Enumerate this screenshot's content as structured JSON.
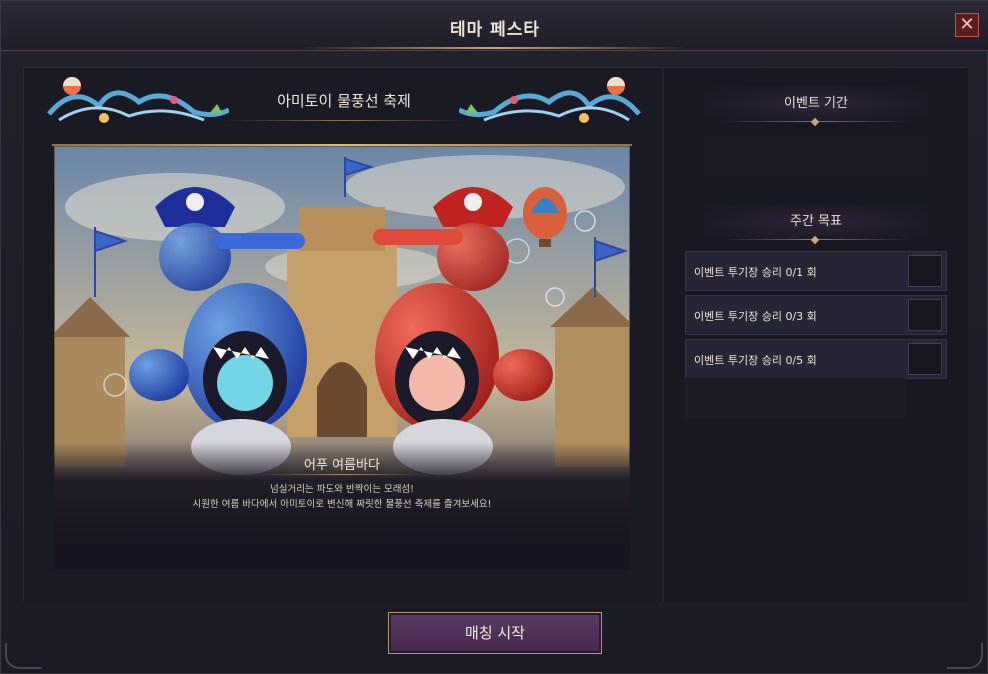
{
  "window": {
    "title": "테마 페스타",
    "close_label": "✕"
  },
  "event": {
    "name": "아미토이 물풍선 축제",
    "subtitle": "어푸 여름바다",
    "description_line1": "넘실거리는 파도와 반짝이는 모래섬!",
    "description_line2": "시원한 여름 바다에서 아미토이로 변신해 짜릿한 물풍선 축제를 즐겨보세요!"
  },
  "sidebar": {
    "period_title": "이벤트 기간",
    "weekly_goal_title": "주간 목표",
    "goals": [
      {
        "label": "이벤트 투기장 승리 0/1 회"
      },
      {
        "label": "이벤트 투기장 승리 0/3 회"
      },
      {
        "label": "이벤트 투기장 승리 0/5 회"
      }
    ]
  },
  "footer": {
    "match_button": "매칭 시작"
  },
  "colors": {
    "accent_gold": "#c8a878",
    "button_purple": "#5b3a62",
    "close_red": "#c0564a",
    "team_blue": "#2a55c8",
    "team_red": "#d23a32"
  }
}
